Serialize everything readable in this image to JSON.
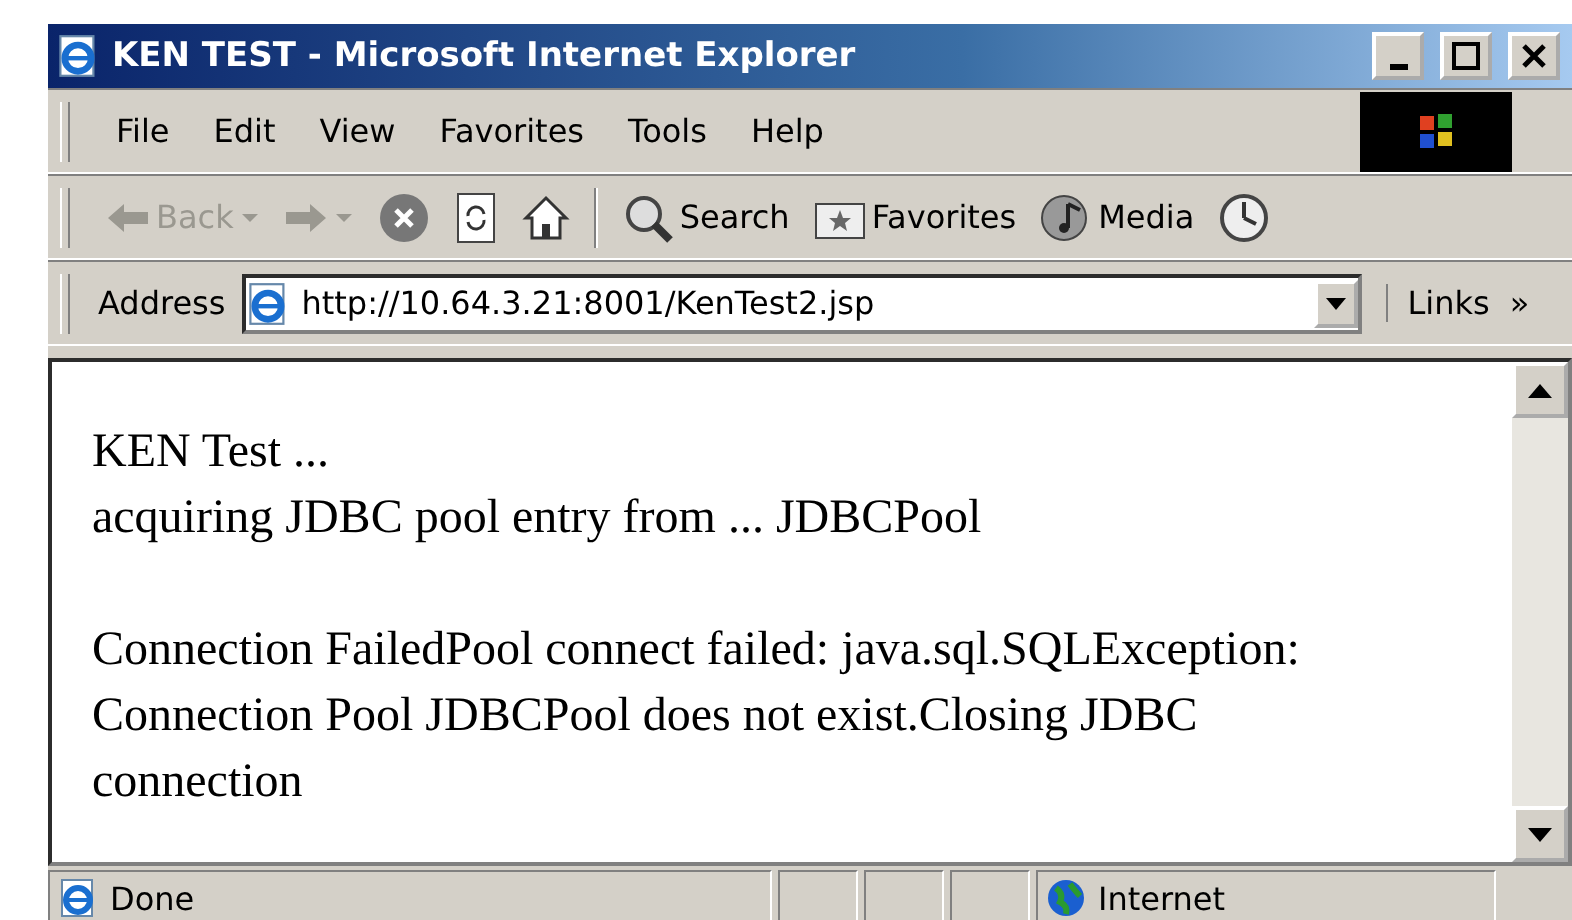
{
  "window": {
    "title": "KEN TEST - Microsoft Internet Explorer"
  },
  "menu": [
    "File",
    "Edit",
    "View",
    "Favorites",
    "Tools",
    "Help"
  ],
  "toolbar": [
    {
      "kind": "nav",
      "label": "Back",
      "disabled": true
    },
    {
      "kind": "navicon",
      "disabled": true
    },
    {
      "kind": "stop"
    },
    {
      "kind": "refresh"
    },
    {
      "kind": "home"
    },
    {
      "kind": "sep"
    },
    {
      "kind": "search",
      "label": "Search"
    },
    {
      "kind": "favorites",
      "label": "Favorites"
    },
    {
      "kind": "media",
      "label": "Media"
    },
    {
      "kind": "history"
    }
  ],
  "address": {
    "label": "Address",
    "value": "http://10.64.3.21:8001/KenTest2.jsp",
    "links": "Links",
    "chevron": "»"
  },
  "content": {
    "lines": [
      [
        "KEN Test ...",
        "acquiring JDBC pool entry from ... JDBCPool"
      ],
      [
        "Connection FailedPool connect failed: java.sql.SQLException: Connection Pool JDBCPool does not exist.Closing JDBC connection"
      ]
    ]
  },
  "status_bar": {
    "text": "Done",
    "zone": "Internet"
  }
}
